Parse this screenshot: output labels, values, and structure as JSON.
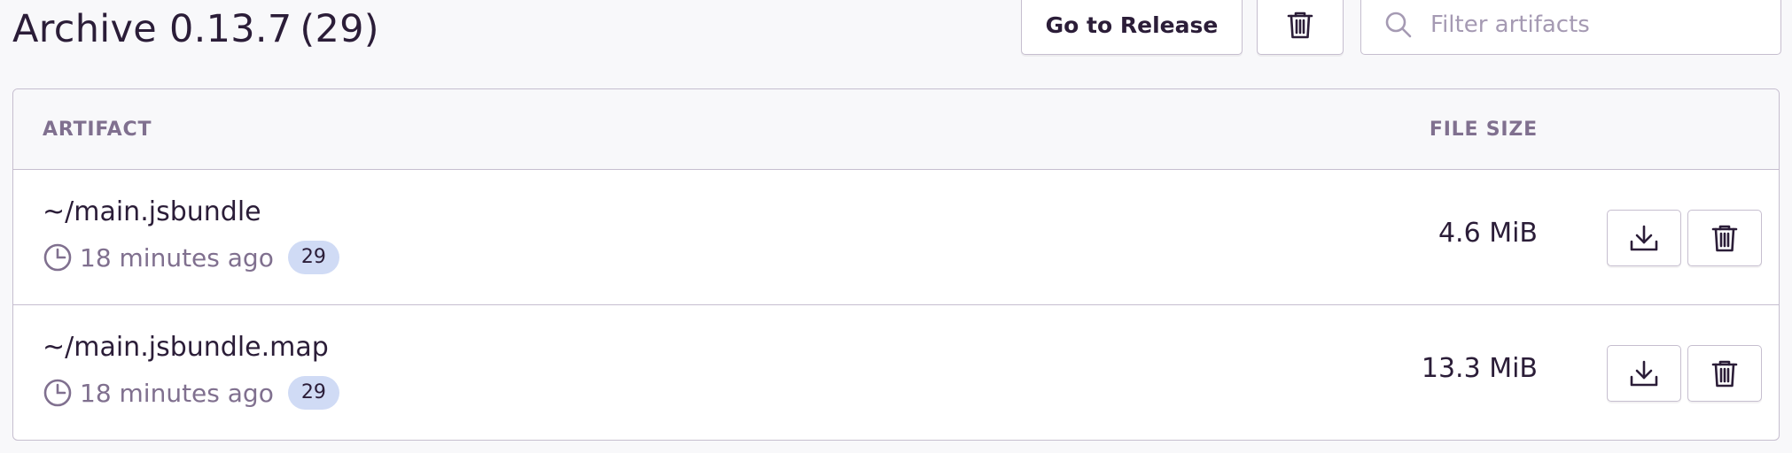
{
  "header": {
    "title": "Archive 0.13.7 (29)",
    "go_to_release_label": "Go to Release",
    "delete_icon": "trash-icon"
  },
  "search": {
    "placeholder": "Filter artifacts",
    "value": "",
    "icon": "search-icon"
  },
  "table": {
    "columns": {
      "artifact": "ARTIFACT",
      "file_size": "FILE SIZE"
    },
    "rows": [
      {
        "name": "~/main.jsbundle",
        "time": "18 minutes ago",
        "badge": "29",
        "size": "4.6 MiB"
      },
      {
        "name": "~/main.jsbundle.map",
        "time": "18 minutes ago",
        "badge": "29",
        "size": "13.3 MiB"
      }
    ]
  },
  "colors": {
    "text": "#2b1d38",
    "muted": "#80708f",
    "border": "#c6becf",
    "badge_bg": "#d0dbf5",
    "page_bg": "#f8f8fa"
  }
}
